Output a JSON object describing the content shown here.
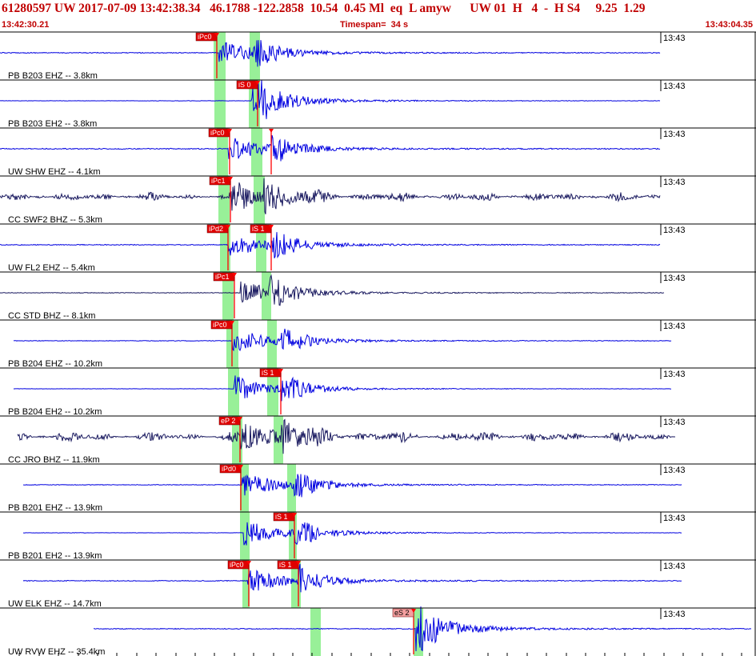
{
  "header": {
    "main": "61280597 UW 2017-07-09 13:42:38.34   46.1788 -122.2858  10.54  0.45 Ml  eq  L amyw      UW 01  H   4  -  H S4     9.25  1.29",
    "start_time": "13:42:30.21",
    "timespan": "Timespan=  34 s",
    "end_time": "13:43:04.35"
  },
  "colors": {
    "header_text": "#c00000",
    "trace_blue": "#0000e0",
    "trace_dark": "#1a1a60",
    "pick_red": "#ff0000",
    "pick_label_bg": "#e00000",
    "emergent_label_bg": "#f4a0a0",
    "window_green": "#98f098",
    "separator": "#000000"
  },
  "chart_data": {
    "type": "seismogram",
    "time_window": [
      "13:42:30.21",
      "13:43:04.35"
    ],
    "timespan_s": 34,
    "minute_mark": "13:43",
    "traces": [
      {
        "label": "PB B203 EHZ -- 3.8km",
        "color": "blue",
        "start_s": 0.0,
        "end_s": 33.8,
        "amp": 1.0,
        "event_s": 11.2,
        "noise": 0.08,
        "s_s": 13.0,
        "picks": [
          {
            "label": "iPc0",
            "t": 11.1,
            "kind": "P"
          }
        ],
        "windows": [
          {
            "t0": 10.95,
            "t1": 11.55
          },
          {
            "t0": 12.8,
            "t1": 13.3
          }
        ]
      },
      {
        "label": "PB B203 EH2 -- 3.8km",
        "color": "blue",
        "start_s": 0.0,
        "end_s": 33.8,
        "amp": 1.0,
        "event_s": 12.9,
        "noise": 0.03,
        "s_s": 13.2,
        "picks": [
          {
            "label": "iS 0",
            "t": 13.2,
            "kind": "S"
          }
        ],
        "windows": [
          {
            "t0": 11.0,
            "t1": 11.55
          },
          {
            "t0": 12.75,
            "t1": 13.3
          }
        ]
      },
      {
        "label": "UW SHW EHZ -- 4.1km",
        "color": "blue",
        "start_s": 0.0,
        "end_s": 33.8,
        "amp": 1.0,
        "event_s": 11.7,
        "noise": 0.1,
        "s_s": 13.9,
        "picks": [
          {
            "label": "iPc0",
            "t": 11.75,
            "kind": "P"
          },
          {
            "label": "",
            "t": 13.9,
            "kind": "S"
          }
        ],
        "windows": [
          {
            "t0": 11.1,
            "t1": 11.7
          },
          {
            "t0": 12.85,
            "t1": 13.45
          }
        ]
      },
      {
        "label": "CC SWF2 BHZ -- 5.3km",
        "color": "dark",
        "start_s": 0.0,
        "end_s": 33.8,
        "amp": 1.0,
        "event_s": 11.8,
        "noise": 0.35,
        "s_s": 13.5,
        "picks": [
          {
            "label": "iPc1",
            "t": 11.8,
            "kind": "P"
          }
        ],
        "windows": [
          {
            "t0": 11.2,
            "t1": 11.75
          },
          {
            "t0": 13.0,
            "t1": 13.55
          }
        ]
      },
      {
        "label": "UW FL2 EHZ -- 5.4km",
        "color": "blue",
        "start_s": 0.0,
        "end_s": 33.8,
        "amp": 1.0,
        "event_s": 11.7,
        "noise": 0.08,
        "s_s": 13.9,
        "picks": [
          {
            "label": "iPd2",
            "t": 11.7,
            "kind": "P"
          },
          {
            "label": "iS 1",
            "t": 13.9,
            "kind": "S"
          }
        ],
        "windows": [
          {
            "t0": 11.25,
            "t1": 11.8
          },
          {
            "t0": 13.1,
            "t1": 13.65
          }
        ]
      },
      {
        "label": "CC STD BHZ -- 8.1km",
        "color": "dark",
        "start_s": 0.0,
        "end_s": 34.0,
        "amp": 1.0,
        "event_s": 12.3,
        "noise": 0.06,
        "s_s": 13.8,
        "picks": [
          {
            "label": "iPc1",
            "t": 12.0,
            "kind": "P"
          }
        ],
        "windows": [
          {
            "t0": 11.4,
            "t1": 11.95
          },
          {
            "t0": 13.4,
            "t1": 13.9
          }
        ]
      },
      {
        "label": "PB B204 EHZ -- 10.2km",
        "color": "blue",
        "start_s": 0.7,
        "end_s": 34.4,
        "amp": 1.0,
        "event_s": 11.9,
        "noise": 0.06,
        "s_s": 14.3,
        "picks": [
          {
            "label": "iPc0",
            "t": 11.9,
            "kind": "P"
          }
        ],
        "windows": [
          {
            "t0": 11.6,
            "t1": 12.2
          },
          {
            "t0": 13.7,
            "t1": 14.2
          }
        ]
      },
      {
        "label": "PB B204 EH2 -- 10.2km",
        "color": "blue",
        "start_s": 0.7,
        "end_s": 34.4,
        "amp": 1.0,
        "event_s": 12.0,
        "noise": 0.03,
        "s_s": 14.4,
        "picks": [
          {
            "label": "iS 1",
            "t": 14.4,
            "kind": "S"
          }
        ],
        "windows": [
          {
            "t0": 11.7,
            "t1": 12.25
          },
          {
            "t0": 13.7,
            "t1": 14.25
          }
        ]
      },
      {
        "label": "CC JRO BHZ -- 11.9km",
        "color": "dark",
        "start_s": 0.9,
        "end_s": 34.6,
        "amp": 1.0,
        "event_s": 12.3,
        "noise": 0.45,
        "s_s": 14.4,
        "picks": [
          {
            "label": "eP 2",
            "t": 12.3,
            "kind": "P"
          }
        ],
        "windows": [
          {
            "t0": 11.9,
            "t1": 12.4
          },
          {
            "t0": 14.0,
            "t1": 14.5
          }
        ]
      },
      {
        "label": "PB B201 EHZ -- 13.9km",
        "color": "blue",
        "start_s": 1.2,
        "end_s": 34.9,
        "amp": 1.0,
        "event_s": 12.4,
        "noise": 0.06,
        "s_s": 15.0,
        "picks": [
          {
            "label": "iPd0",
            "t": 12.35,
            "kind": "P"
          }
        ],
        "windows": [
          {
            "t0": 12.3,
            "t1": 12.75
          },
          {
            "t0": 14.7,
            "t1": 15.15
          }
        ]
      },
      {
        "label": "PB B201 EH2 -- 13.9km",
        "color": "blue",
        "start_s": 1.2,
        "end_s": 34.9,
        "amp": 1.0,
        "event_s": 12.5,
        "noise": 0.03,
        "s_s": 15.1,
        "picks": [
          {
            "label": "iS 1",
            "t": 15.1,
            "kind": "S"
          }
        ],
        "windows": [
          {
            "t0": 12.3,
            "t1": 12.8
          },
          {
            "t0": 14.8,
            "t1": 15.2
          }
        ]
      },
      {
        "label": "UW ELK EHZ -- 14.7km",
        "color": "blue",
        "start_s": 1.2,
        "end_s": 34.9,
        "amp": 1.0,
        "event_s": 12.7,
        "noise": 0.08,
        "s_s": 15.3,
        "picks": [
          {
            "label": "iPc0",
            "t": 12.75,
            "kind": "P"
          },
          {
            "label": "iS 1",
            "t": 15.3,
            "kind": "S"
          }
        ],
        "windows": [
          {
            "t0": 12.4,
            "t1": 12.8
          },
          {
            "t0": 14.9,
            "t1": 15.4
          }
        ]
      },
      {
        "label": "UW RVW EHZ -- 35.4km",
        "color": "blue",
        "start_s": 4.8,
        "end_s": 38.5,
        "amp": 1.0,
        "event_s": 21.3,
        "noise": 0.08,
        "s_s": 21.3,
        "picks": [
          {
            "label": "eS 2",
            "t": 21.2,
            "kind": "E"
          }
        ],
        "windows": [
          {
            "t0": 15.9,
            "t1": 16.45
          },
          {
            "t0": 21.2,
            "t1": 21.7
          }
        ]
      }
    ]
  }
}
